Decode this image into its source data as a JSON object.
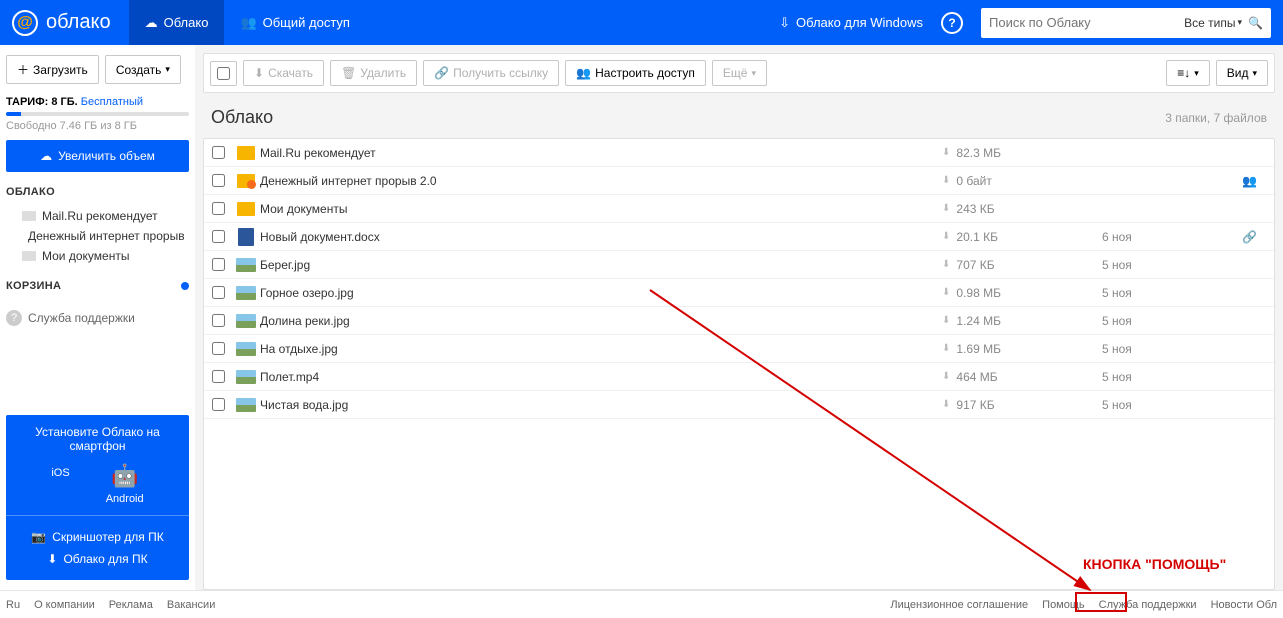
{
  "header": {
    "brand": "облако",
    "tabs": {
      "cloud": "Облако",
      "shared": "Общий доступ"
    },
    "windowsLink": "Облако для Windows",
    "searchPlaceholder": "Поиск по Облаку",
    "searchType": "Все типы"
  },
  "sidebar": {
    "upload": "Загрузить",
    "create": "Создать",
    "tariffLabel": "ТАРИФ: 8 ГБ.",
    "tariffPlan": "Бесплатный",
    "freeSpace": "Свободно 7.46 ГБ из 8 ГБ",
    "increase": "Увеличить объем",
    "cloudTitle": "ОБЛАКО",
    "tree": [
      "Mail.Ru рекомендует",
      "Денежный интернет прорыв ...",
      "Мои документы"
    ],
    "trashTitle": "КОРЗИНА",
    "support": "Служба поддержки",
    "promoTitle": "Установите Облако на смартфон",
    "ios": "iOS",
    "android": "Android",
    "screenshoter": "Скриншотер для ПК",
    "desktop": "Облако для ПК"
  },
  "toolbar": {
    "download": "Скачать",
    "delete": "Удалить",
    "link": "Получить ссылку",
    "access": "Настроить доступ",
    "more": "Ещё",
    "view": "Вид"
  },
  "breadcrumb": {
    "title": "Облако",
    "info": "3 папки, 7 файлов"
  },
  "files": [
    {
      "name": "Mail.Ru рекомендует",
      "type": "folder",
      "size": "82.3 МБ",
      "date": "",
      "extra": ""
    },
    {
      "name": "Денежный интернет прорыв 2.0",
      "type": "folder-shared",
      "size": "0 байт",
      "date": "",
      "extra": "shared"
    },
    {
      "name": "Мои документы",
      "type": "folder",
      "size": "243 КБ",
      "date": "",
      "extra": ""
    },
    {
      "name": "Новый документ.docx",
      "type": "doc",
      "size": "20.1 КБ",
      "date": "6 ноя",
      "extra": "link"
    },
    {
      "name": "Берег.jpg",
      "type": "img",
      "size": "707 КБ",
      "date": "5 ноя",
      "extra": ""
    },
    {
      "name": "Горное озеро.jpg",
      "type": "img",
      "size": "0.98 МБ",
      "date": "5 ноя",
      "extra": ""
    },
    {
      "name": "Долина реки.jpg",
      "type": "img",
      "size": "1.24 МБ",
      "date": "5 ноя",
      "extra": ""
    },
    {
      "name": "На отдыхе.jpg",
      "type": "img",
      "size": "1.69 МБ",
      "date": "5 ноя",
      "extra": ""
    },
    {
      "name": "Полет.mp4",
      "type": "img",
      "size": "464 МБ",
      "date": "5 ноя",
      "extra": ""
    },
    {
      "name": "Чистая вода.jpg",
      "type": "img",
      "size": "917 КБ",
      "date": "5 ноя",
      "extra": ""
    }
  ],
  "footer": {
    "left": [
      "Ru",
      "О компании",
      "Реклама",
      "Вакансии"
    ],
    "right": [
      "Лицензионное соглашение",
      "Помощь",
      "Служба поддержки",
      "Новости Обл"
    ]
  },
  "annotation": {
    "label": "КНОПКА \"ПОМОЩЬ\""
  }
}
